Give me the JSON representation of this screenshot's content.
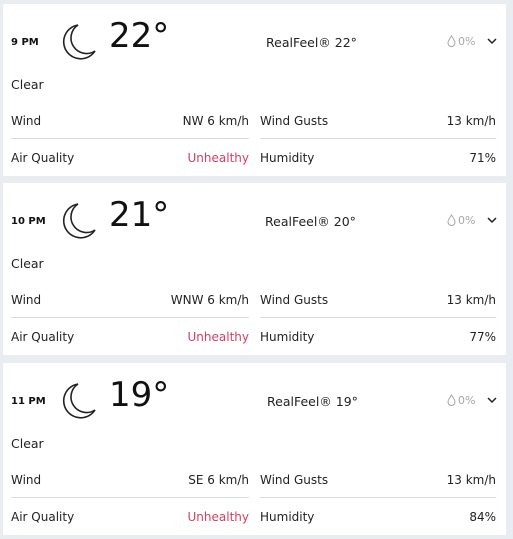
{
  "hours": [
    {
      "time": "9 PM",
      "icon": "moon-icon",
      "temp": "22°",
      "realfeel": "RealFeel® 22°",
      "precip": "0%",
      "phrase": "Clear",
      "wind_label": "Wind",
      "wind_value": "NW 6 km/h",
      "gusts_label": "Wind Gusts",
      "gusts_value": "13 km/h",
      "aq_label": "Air Quality",
      "aq_value": "Unhealthy",
      "humidity_label": "Humidity",
      "humidity_value": "71%"
    },
    {
      "time": "10 PM",
      "icon": "moon-icon",
      "temp": "21°",
      "realfeel": "RealFeel® 20°",
      "precip": "0%",
      "phrase": "Clear",
      "wind_label": "Wind",
      "wind_value": "WNW 6 km/h",
      "gusts_label": "Wind Gusts",
      "gusts_value": "13 km/h",
      "aq_label": "Air Quality",
      "aq_value": "Unhealthy",
      "humidity_label": "Humidity",
      "humidity_value": "77%"
    },
    {
      "time": "11 PM",
      "icon": "moon-icon",
      "temp": "19°",
      "realfeel": "RealFeel® 19°",
      "precip": "0%",
      "phrase": "Clear",
      "wind_label": "Wind",
      "wind_value": "SE 6 km/h",
      "gusts_label": "Wind Gusts",
      "gusts_value": "13 km/h",
      "aq_label": "Air Quality",
      "aq_value": "Unhealthy",
      "humidity_label": "Humidity",
      "humidity_value": "84%"
    }
  ],
  "colors": {
    "page_bg": "#e9edf1",
    "card_bg": "#ffffff",
    "unhealthy": "#d33f62",
    "muted": "#a6a6a6"
  }
}
